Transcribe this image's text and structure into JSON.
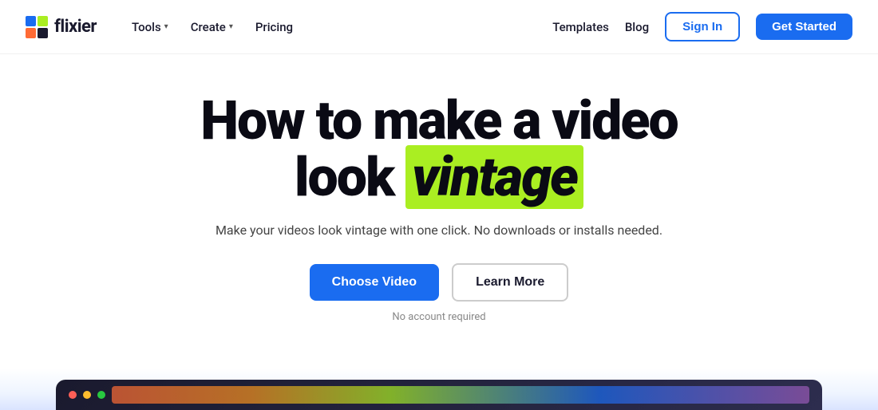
{
  "nav": {
    "logo_text": "flixier",
    "items_left": [
      {
        "label": "Tools",
        "has_dropdown": true
      },
      {
        "label": "Create",
        "has_dropdown": true
      },
      {
        "label": "Pricing",
        "has_dropdown": false
      }
    ],
    "items_right": [
      {
        "label": "Templates"
      },
      {
        "label": "Blog"
      }
    ],
    "signin_label": "Sign In",
    "getstarted_label": "Get Started"
  },
  "hero": {
    "title_line1": "How to make a video",
    "title_line2_prefix": "look ",
    "title_highlight": "vintage",
    "subtitle": "Make your videos look vintage with one click. No downloads or installs needed.",
    "btn_choose": "Choose Video",
    "btn_learn": "Learn More",
    "no_account": "No account required"
  }
}
